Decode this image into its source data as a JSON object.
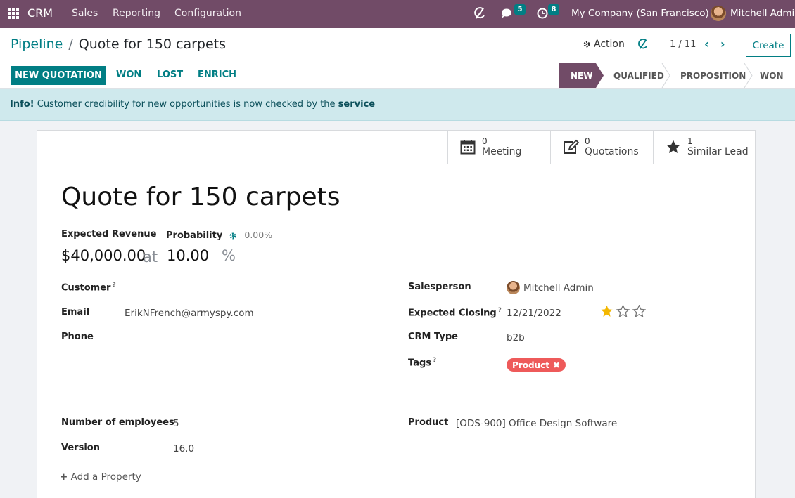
{
  "topbar": {
    "app": "CRM",
    "menu": [
      "Sales",
      "Reporting",
      "Configuration"
    ],
    "chat_count": "5",
    "activity_count": "8",
    "company": "My Company (San Francisco)",
    "user": "Mitchell Admin"
  },
  "control": {
    "breadcrumb_parent": "Pipeline",
    "breadcrumb_sep": "/",
    "breadcrumb_current": "Quote for 150 carpets",
    "action": "Action",
    "pager": "1 / 11",
    "create": "Create"
  },
  "statusbar": {
    "new_quotation": "NEW QUOTATION",
    "won": "WON",
    "lost": "LOST",
    "enrich": "ENRICH",
    "stages": [
      "NEW",
      "QUALIFIED",
      "PROPOSITION",
      "WON"
    ],
    "active_stage": "NEW"
  },
  "alert": {
    "prefix": "Info!",
    "message": " Customer credibility for new opportunities is now checked by the ",
    "link": "service"
  },
  "smart_buttons": {
    "meeting": {
      "count": "0",
      "label": "Meeting"
    },
    "quotations": {
      "count": "0",
      "label": "Quotations"
    },
    "similar": {
      "count": "1",
      "label": "Similar Lead"
    }
  },
  "form": {
    "title": "Quote for 150 carpets",
    "expected_revenue_label": "Expected Revenue",
    "expected_revenue": "$40,000.00",
    "at": "at",
    "probability_label": "Probability",
    "probability_auto": "0.00%",
    "probability": "10.00",
    "percent": "%",
    "customer_label": "Customer",
    "email_label": "Email",
    "email": "ErikNFrench@armyspy.com",
    "phone_label": "Phone",
    "salesperson_label": "Salesperson",
    "salesperson": "Mitchell Admin",
    "closing_label": "Expected Closing",
    "closing": "12/21/2022",
    "priority_stars": 1,
    "crm_type_label": "CRM Type",
    "crm_type": "b2b",
    "tags_label": "Tags",
    "tag": "Product",
    "employees_label": "Number of employees",
    "employees": "5",
    "version_label": "Version",
    "version": "16.0",
    "product_label": "Product",
    "product": "[ODS-900] Office Design Software",
    "add_property": "Add a Property",
    "help_mark": "?"
  },
  "colors": {
    "brand": "#714b67",
    "accent": "#017e84",
    "tag": "#ee5a5a",
    "star": "#f3b700",
    "info_bg": "#cfe9ed"
  }
}
